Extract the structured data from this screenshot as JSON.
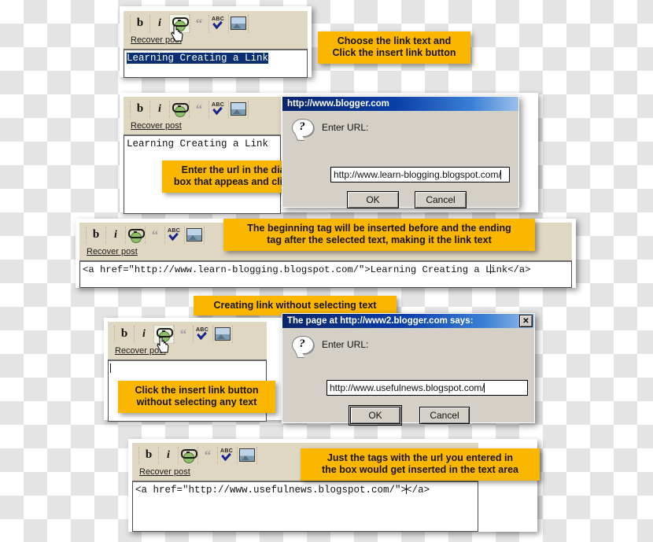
{
  "toolbar": {
    "buttons": [
      {
        "name": "bold",
        "label": "b"
      },
      {
        "name": "italic",
        "label": "i"
      },
      {
        "name": "insert-link",
        "label": "link"
      },
      {
        "name": "blockquote",
        "label": "“"
      },
      {
        "name": "spell-check",
        "label": "ABC"
      },
      {
        "name": "insert-image",
        "label": "image"
      }
    ],
    "recover_label": "Recover post",
    "abc_label": "ABC"
  },
  "step1": {
    "editor_text_selected": "Learning Creating a L",
    "editor_text_after_caret": "ink",
    "callout": "Choose the link text and\nClick the insert link button"
  },
  "step2": {
    "editor_text": "Learning Creating a Link",
    "callout": "Enter the url in the dialog\nbox that appeas and click ok",
    "dialog": {
      "title": "http://www.blogger.com",
      "prompt": "Enter URL:",
      "input_value": "http://www.learn-blogging.blogspot.com/",
      "ok_label": "OK",
      "cancel_label": "Cancel"
    }
  },
  "step3": {
    "callout": "The beginning tag will be inserted before and the ending\ntag after the selected text, making it the link text",
    "code_before_caret": "<a href=\"http://www.learn-blogging.blogspot.com/\">Learning Creating a L",
    "code_after_caret": "ink</a>"
  },
  "step4": {
    "heading_callout": "Creating link without selecting text",
    "callout": "Click the insert link button\nwithout selecting any text",
    "editor_text": "",
    "dialog": {
      "title": "The page at http://www2.blogger.com says:",
      "close_label": "✕",
      "prompt": "Enter URL:",
      "input_value": "http://www.usefulnews.blogspot.com/",
      "ok_label": "OK",
      "cancel_label": "Cancel"
    }
  },
  "step5": {
    "callout": "Just the tags with the url you entered in\nthe box would get inserted in the text area",
    "code_before_caret": "<a href=\"http://www.usefulnews.blogspot.com/\">",
    "code_after_caret": "</a>"
  },
  "colors": {
    "callout_bg": "#fbb700",
    "toolbar_bg": "#e0d7c3",
    "dialog_bg": "#d4d0c8",
    "titlebar_start": "#0a246a",
    "selection_bg": "#0a2f72"
  }
}
